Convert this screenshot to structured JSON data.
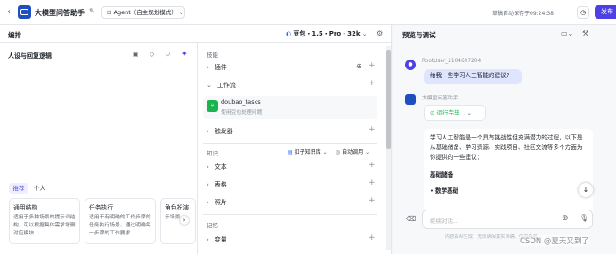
{
  "header": {
    "title": "大模型问答助手",
    "agent_mode": "Agent（自主规划模式）",
    "autosave": "草稿自动保存于09:24:38",
    "publish": "发布"
  },
  "left": {
    "title": "编排",
    "model": "豆包・1.5・Pro・32k"
  },
  "persona": {
    "title": "人设与回复逻辑",
    "tabs": [
      "推荐",
      "个人"
    ],
    "cards": [
      {
        "title": "通用结构",
        "desc": "适用于多种场景的提示词结构，可以根据具体需求增删对应模块"
      },
      {
        "title": "任务执行",
        "desc": "适用于有明确的工作步骤的任务执行场景，通过明确每一步骤的工作要求..."
      },
      {
        "title": "角色扮演",
        "desc": "乐场景..."
      }
    ]
  },
  "skills": {
    "title": "技能",
    "plugin": "插件",
    "workflow": "工作流",
    "workflow_item": {
      "name": "doubao_tasks",
      "desc": "使用豆包处理问题"
    },
    "trigger": "触发器"
  },
  "knowledge": {
    "title": "知识",
    "kb_btn": "扣子知识库",
    "auto_call": "自动调用",
    "items": [
      "文本",
      "表格",
      "照片"
    ]
  },
  "memory": {
    "title": "记忆",
    "items": [
      "变量"
    ]
  },
  "preview": {
    "title": "预览与调试",
    "user_name": "RootUser_2104697204",
    "user_msg": "给我一些学习人工智能的建议?",
    "bot_name": "大模型问答助手",
    "run_status": "运行完毕",
    "answer_intro": "学习人工智能是一个具有挑战性但充满潜力的过程，以下是从基础储备、学习资源、实践项目、社区交流等多个方面为你提供的一些建议：",
    "answer_h": "基础储备",
    "answer_li": "数学基础",
    "input_placeholder": "继续对话...",
    "footer": "内容由AI生成，无法确保真实准确，仅供参考。",
    "watermark": "CSDN @夏天又到了"
  }
}
